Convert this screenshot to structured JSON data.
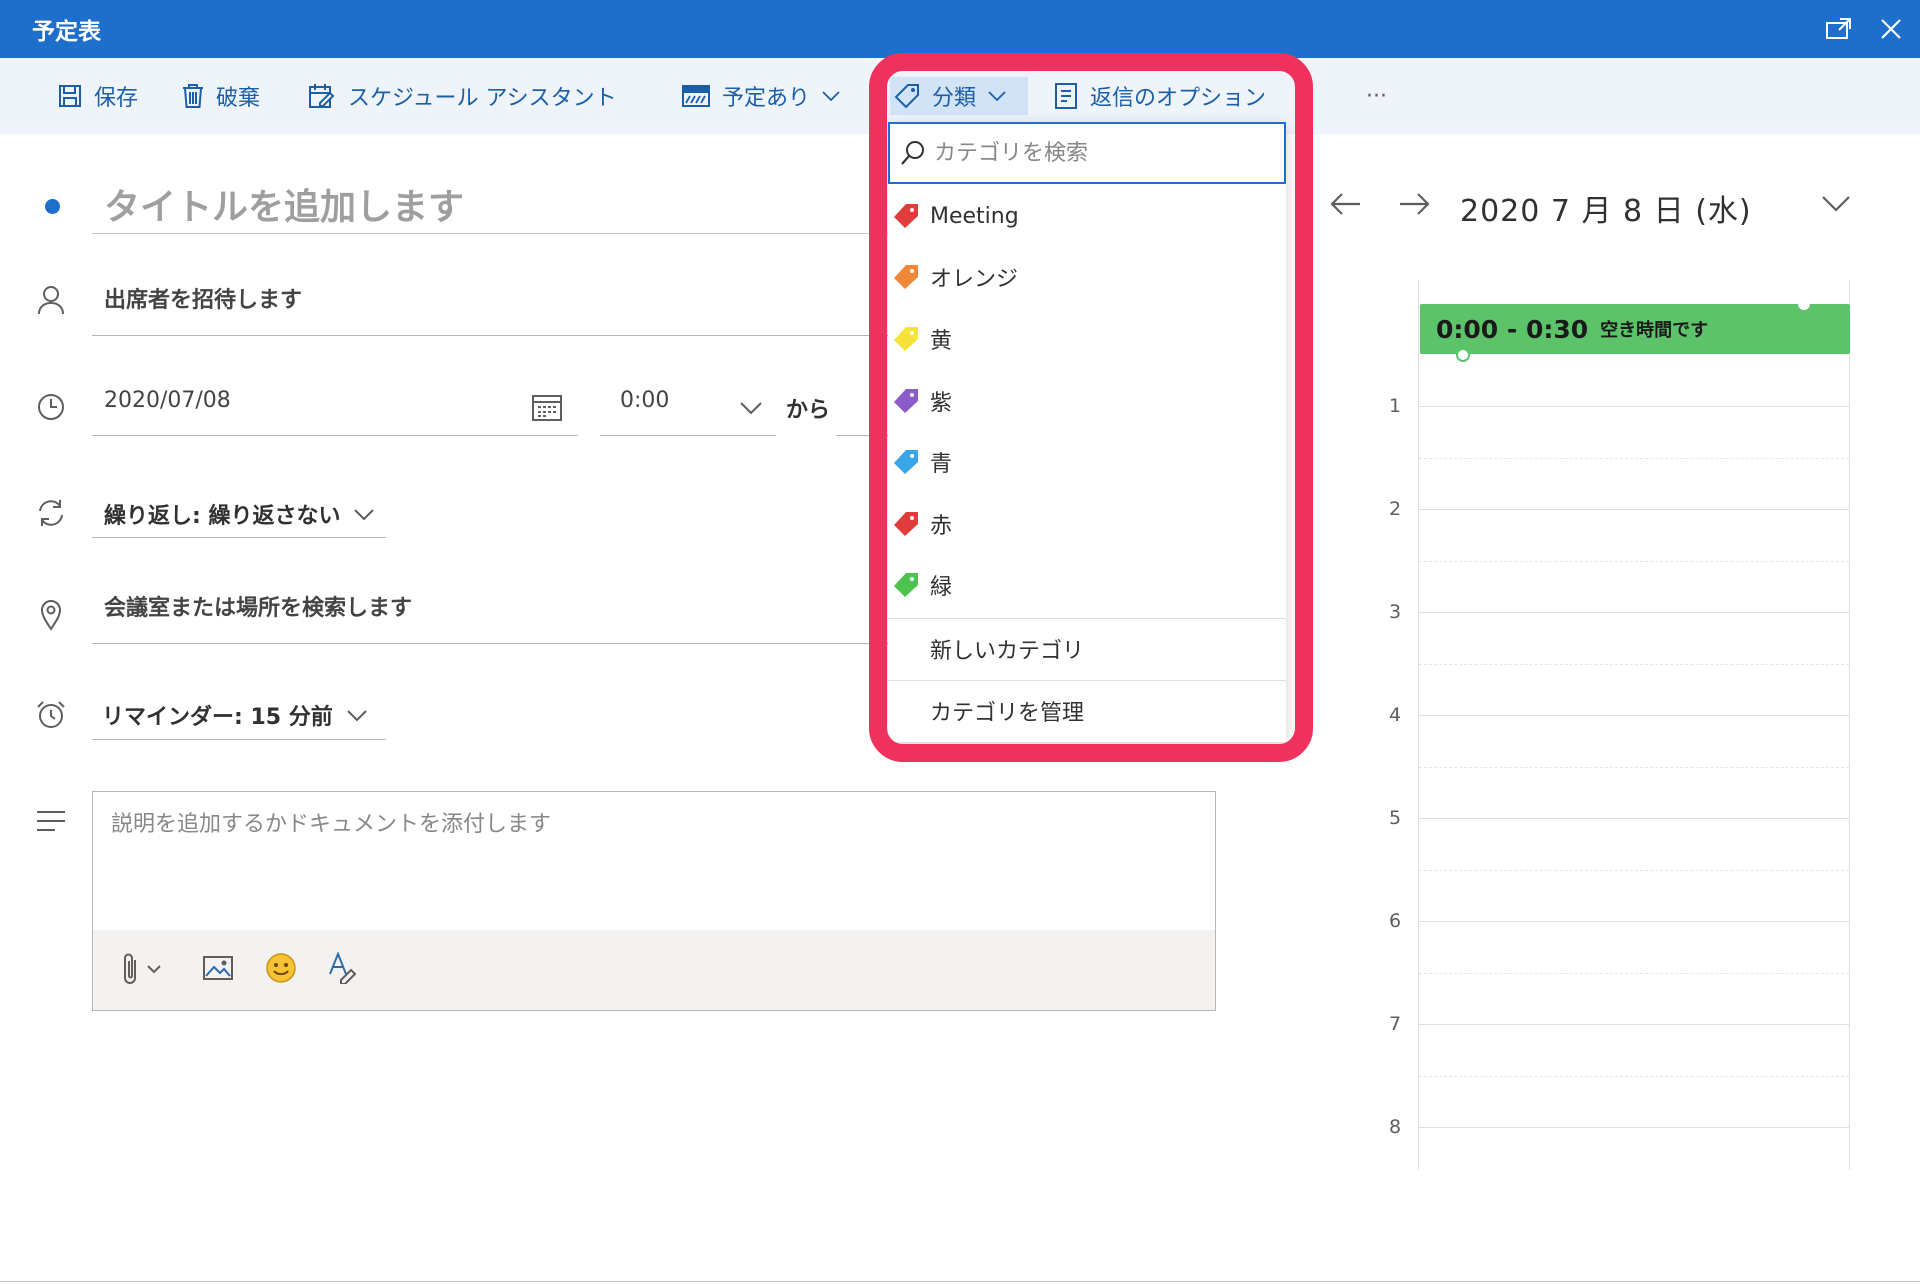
{
  "window": {
    "title": "予定表"
  },
  "toolbar": {
    "save": "保存",
    "discard": "破棄",
    "scheduling_assistant": "スケジュール アシスタント",
    "show_as": "予定あり",
    "categorize": "分類",
    "response_options": "返信のオプション",
    "more": "···"
  },
  "form": {
    "title_placeholder": "タイトルを追加します",
    "attendees_placeholder": "出席者を招待します",
    "date": "2020/07/08",
    "start_time": "0:00",
    "from_label": "から",
    "recurrence": "繰り返し: 繰り返さない",
    "location_placeholder": "会議室または場所を検索します",
    "reminder": "リマインダー: 15 分前",
    "description_placeholder": "説明を追加するかドキュメントを添付します"
  },
  "category_dropdown": {
    "search_placeholder": "カテゴリを検索",
    "items": [
      {
        "label": "Meeting",
        "color": "#e03c3c"
      },
      {
        "label": "オレンジ",
        "color": "#f0883a"
      },
      {
        "label": "黄",
        "color": "#f5e33a"
      },
      {
        "label": "紫",
        "color": "#8b5cc7"
      },
      {
        "label": "青",
        "color": "#3aa6e8"
      },
      {
        "label": "赤",
        "color": "#e03c3c"
      },
      {
        "label": "緑",
        "color": "#4ec24e"
      }
    ],
    "new_category": "新しいカテゴリ",
    "manage_categories": "カテゴリを管理"
  },
  "calendar": {
    "date_label": "2020 7 月 8 日 (水)",
    "hours": [
      "1",
      "2",
      "3",
      "4",
      "5",
      "6",
      "7",
      "8"
    ],
    "event": {
      "time": "0:00 - 0:30",
      "status": "空き時間です",
      "color": "#5cc36a"
    }
  },
  "colors": {
    "accent": "#1e6fcc",
    "highlight": "#f0315e"
  }
}
